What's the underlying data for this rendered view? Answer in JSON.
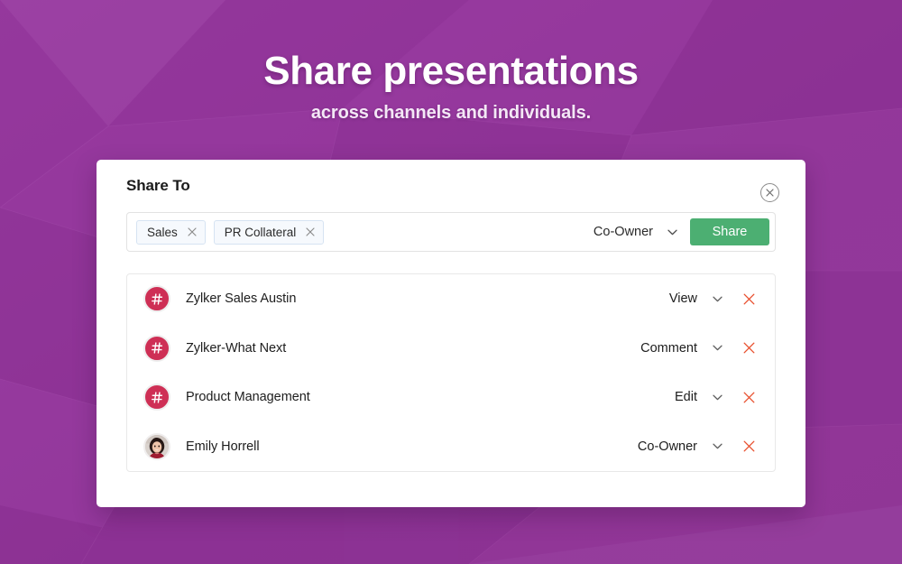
{
  "hero": {
    "title": "Share presentations",
    "subtitle": "across channels and individuals."
  },
  "dialog": {
    "title": "Share To",
    "close_icon": "close-circle-icon",
    "input": {
      "tokens": [
        {
          "label": "Sales",
          "remove_icon": "close-icon"
        },
        {
          "label": "PR Collateral",
          "remove_icon": "close-icon"
        }
      ],
      "permission": "Co-Owner",
      "permission_caret_icon": "chevron-down-icon",
      "share_label": "Share"
    },
    "shared_with": [
      {
        "name": "Zylker Sales Austin",
        "type": "channel",
        "icon": "hash-icon",
        "permission": "View",
        "caret_icon": "chevron-down-icon",
        "remove_icon": "close-icon"
      },
      {
        "name": "Zylker-What Next",
        "type": "channel",
        "icon": "hash-icon",
        "permission": "Comment",
        "caret_icon": "chevron-down-icon",
        "remove_icon": "close-icon"
      },
      {
        "name": "Product Management",
        "type": "channel",
        "icon": "hash-icon",
        "permission": "Edit",
        "caret_icon": "chevron-down-icon",
        "remove_icon": "close-icon"
      },
      {
        "name": "Emily Horrell",
        "type": "person",
        "icon": "user-avatar-photo",
        "permission": "Co-Owner",
        "caret_icon": "chevron-down-icon",
        "remove_icon": "close-icon"
      }
    ]
  },
  "colors": {
    "background_purple": "#92389a",
    "share_button_green": "#4caf72",
    "channel_badge_crimson": "#ce2f55",
    "remove_icon_red": "#e8502f",
    "token_background": "#f6f9fd",
    "token_border": "#d6e3f2"
  }
}
